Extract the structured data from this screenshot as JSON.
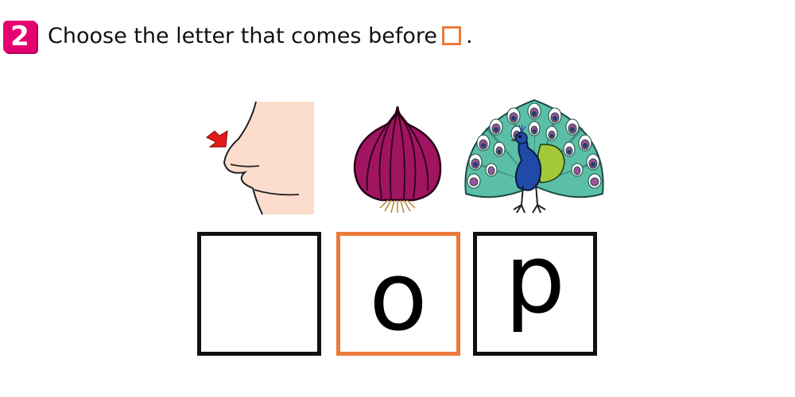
{
  "question": {
    "number": "2",
    "text": "Choose the letter that comes before",
    "end_punct": ".",
    "accent_color": "#ec7a3a",
    "badge_color": "#e4006f"
  },
  "pictures": [
    {
      "name": "nose",
      "icon": "nose-icon"
    },
    {
      "name": "onion",
      "icon": "onion-icon"
    },
    {
      "name": "peacock",
      "icon": "peacock-icon"
    }
  ],
  "boxes": [
    {
      "letter": "",
      "highlighted": false
    },
    {
      "letter": "o",
      "highlighted": true
    },
    {
      "letter": "p",
      "highlighted": false
    }
  ]
}
